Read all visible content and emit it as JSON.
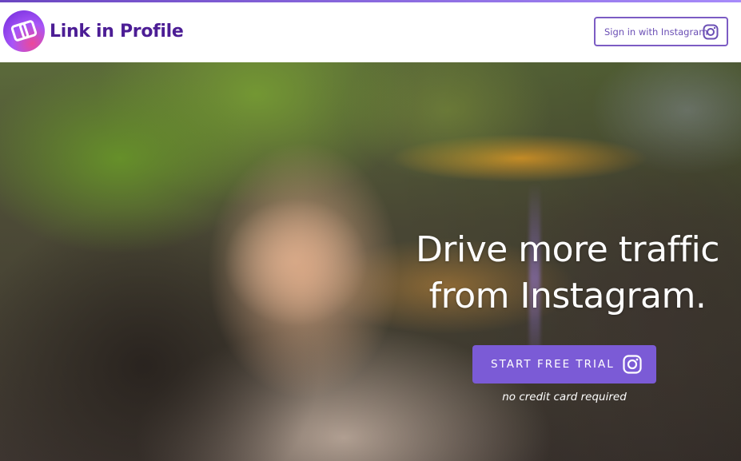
{
  "header": {
    "brand_name": "Link in Profile",
    "signin_label": "Sign in with Instagram"
  },
  "hero": {
    "headline_line1": "Drive more traffic",
    "headline_line2": "from Instagram.",
    "cta_label": "START FREE TRIAL",
    "cta_note": "no credit card required"
  },
  "icons": {
    "logo": "link-squares-logo-icon",
    "signin": "instagram-icon",
    "cta": "instagram-icon"
  },
  "colors": {
    "brand_purple": "#4c1d95",
    "button_purple": "#7b5bd6",
    "outline_purple": "#7c5cc4"
  }
}
